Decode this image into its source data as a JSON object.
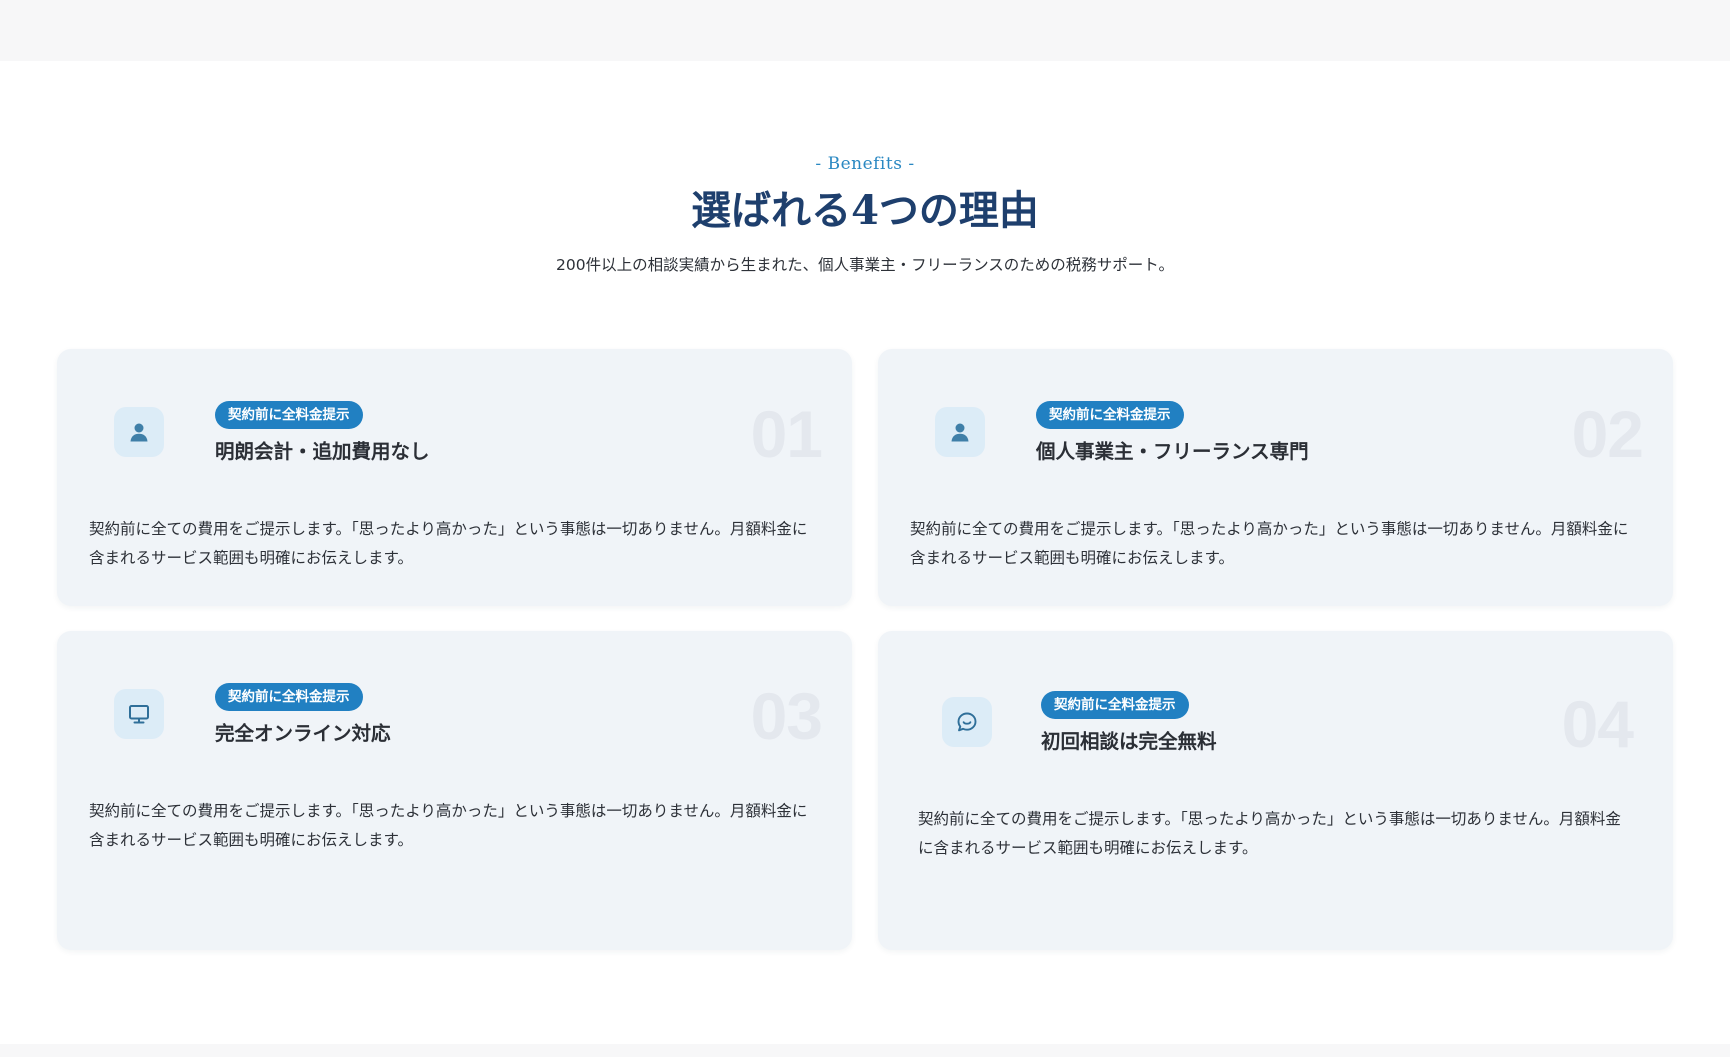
{
  "section": {
    "eyebrow": "- Benefits -",
    "title": "選ばれる4つの理由",
    "subtitle": "200件以上の相談実績から生まれた、個人事業主・フリーランスのための税務サポート。"
  },
  "cards": [
    {
      "icon": "user-icon",
      "badge": "契約前に全料金提示",
      "title": "明朗会計・追加費用なし",
      "number": "01",
      "description": "契約前に全ての費用をご提示します。「思ったより高かった」という事態は一切ありません。月額料金に含まれるサービス範囲も明確にお伝えします。"
    },
    {
      "icon": "user-icon",
      "badge": "契約前に全料金提示",
      "title": "個人事業主・フリーランス専門",
      "number": "02",
      "description": "契約前に全ての費用をご提示します。「思ったより高かった」という事態は一切ありません。月額料金に含まれるサービス範囲も明確にお伝えします。"
    },
    {
      "icon": "monitor-icon",
      "badge": "契約前に全料金提示",
      "title": "完全オンライン対応",
      "number": "03",
      "description": "契約前に全ての費用をご提示します。「思ったより高かった」という事態は一切ありません。月額料金に含まれるサービス範囲も明確にお伝えします。"
    },
    {
      "icon": "chat-icon",
      "badge": "契約前に全料金提示",
      "title": "初回相談は完全無料",
      "number": "04",
      "description": "契約前に全ての費用をご提示します。「思ったより高かった」という事態は一切ありません。月額料金に含まれるサービス範囲も明確にお伝えします。"
    }
  ],
  "colors": {
    "accent": "#2180c2",
    "title": "#1e3f6d",
    "card_background": "#f0f4f8",
    "icon_background": "#dcecf7",
    "icon_color": "#3f7fa8"
  }
}
